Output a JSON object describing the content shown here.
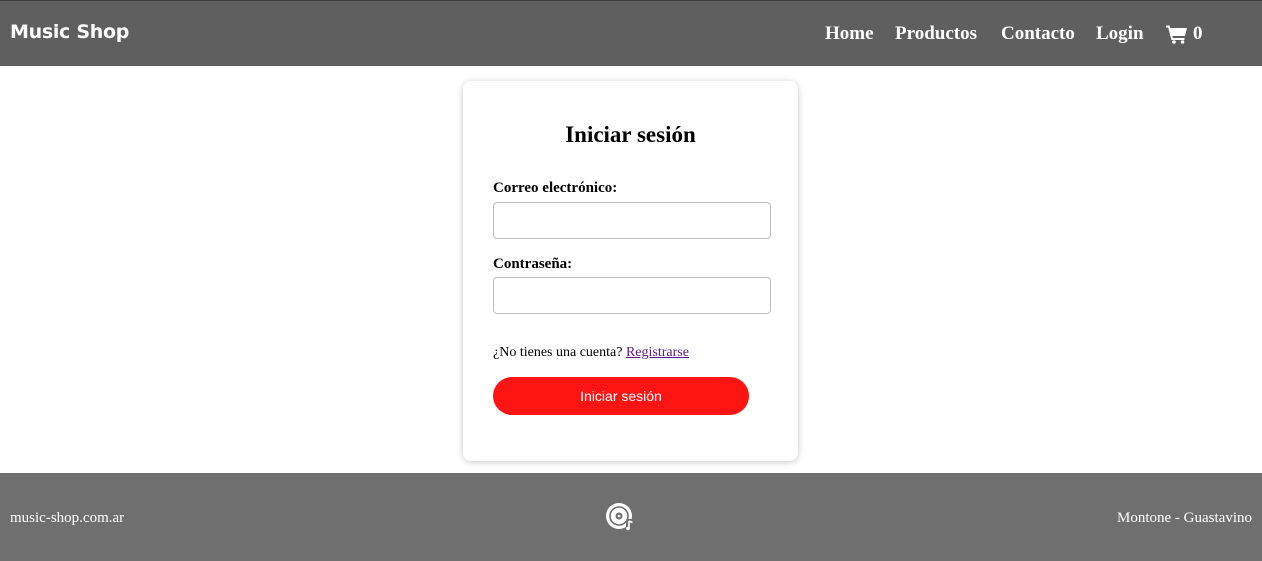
{
  "header": {
    "brand": "Music Shop",
    "nav": {
      "home": "Home",
      "productos": "Productos",
      "contacto": "Contacto",
      "login": "Login"
    },
    "cart_count": "0"
  },
  "login_form": {
    "title": "Iniciar sesión",
    "email_label": "Correo electrónico:",
    "email_value": "",
    "password_label": "Contraseña:",
    "password_value": "",
    "signup_prompt": "¿No tienes una cuenta?",
    "signup_link": "Registrarse",
    "submit_label": "Iniciar sesión"
  },
  "footer": {
    "left_text": "music-shop.com.ar",
    "right_text": "Montone - Guastavino"
  },
  "icons": {
    "cart": "shopping-cart-icon",
    "footer_logo": "vinyl-disc-music-icon"
  },
  "colors": {
    "header_bg": "#5f5f5f",
    "footer_bg": "#6f6f6f",
    "button_bg": "#ff1414",
    "link_color": "#551a8b"
  }
}
